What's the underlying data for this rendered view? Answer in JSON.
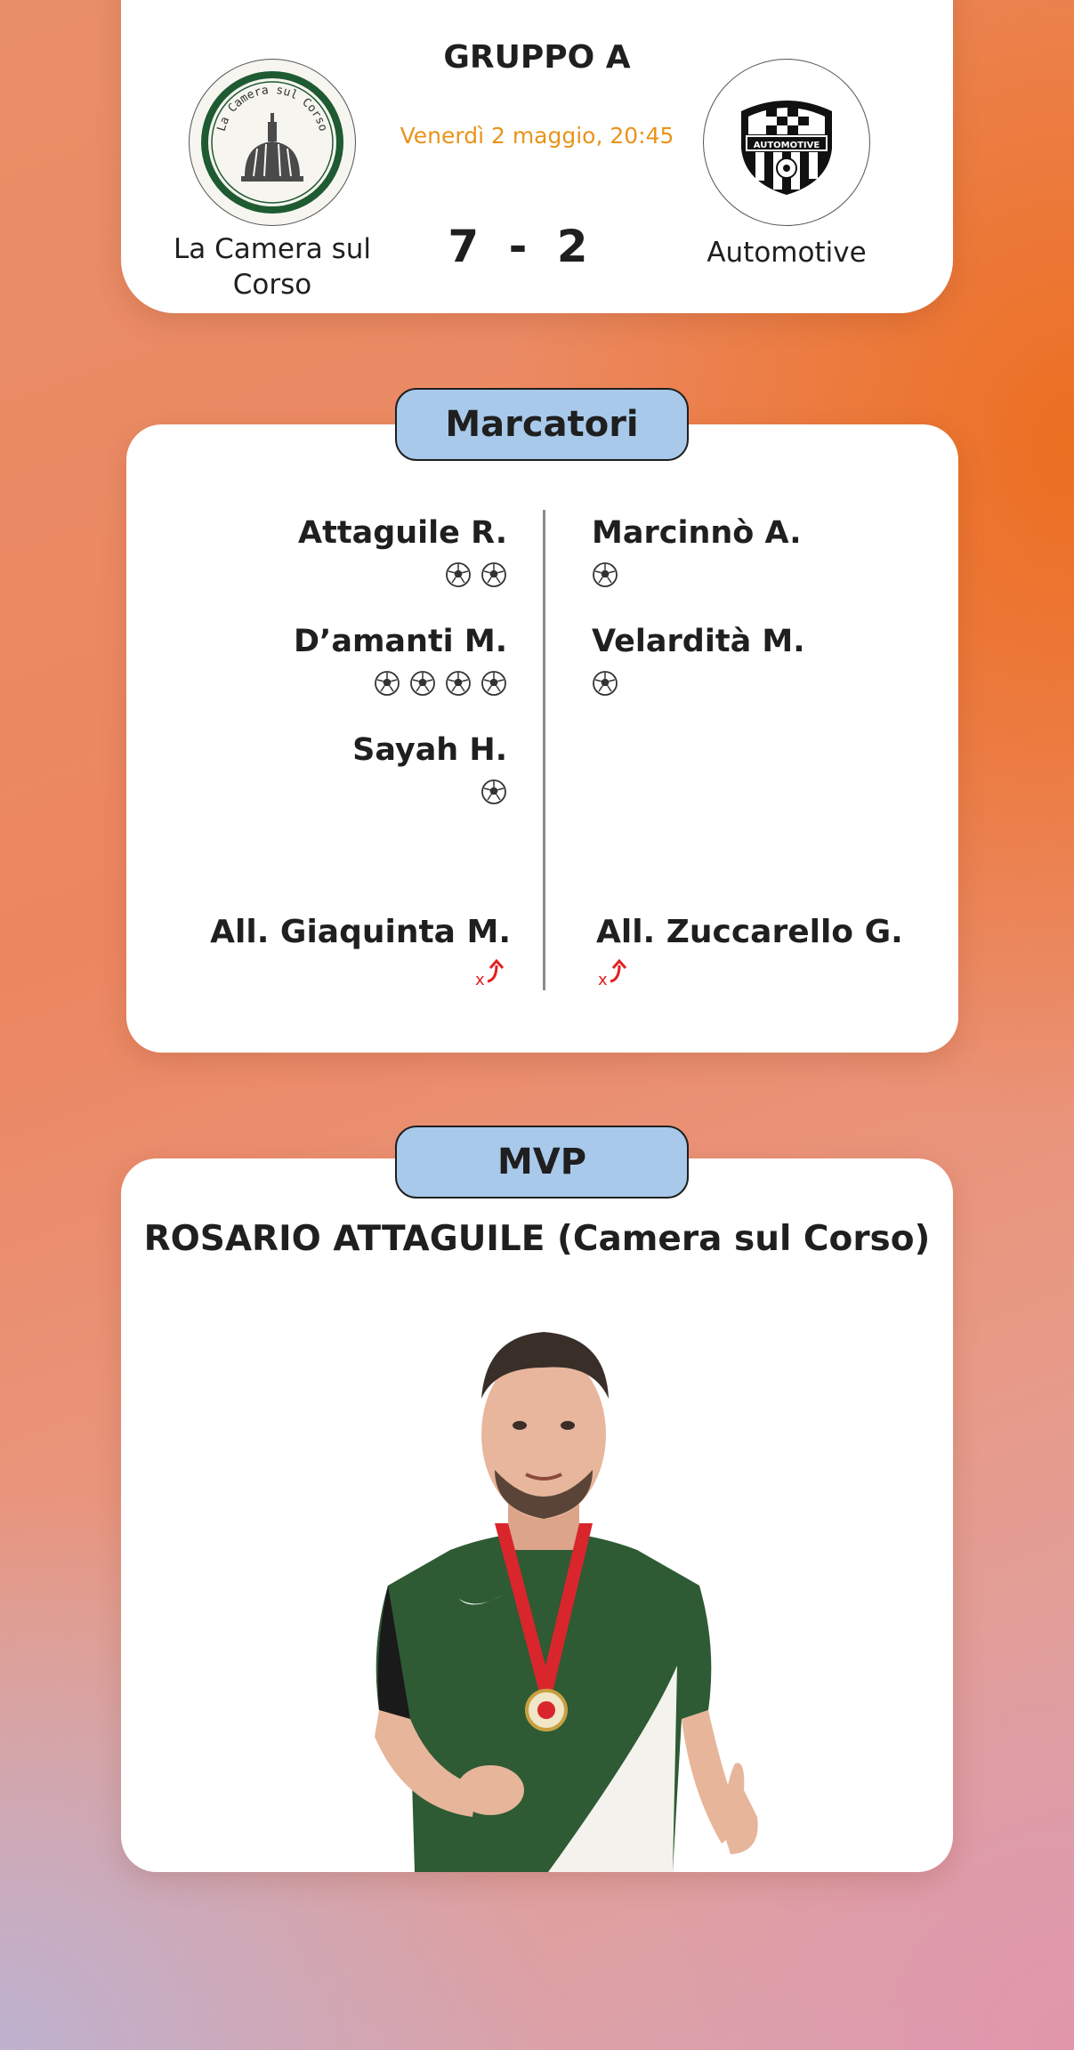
{
  "match": {
    "group": "GRUPPO A",
    "date": "Venerdì 2 maggio, 20:45",
    "home_team": {
      "name": "La Camera sul Corso",
      "logo_text": "La Camera sul Corso",
      "logo_icon": "dome-icon"
    },
    "away_team": {
      "name": "Automotive",
      "logo_text": "AUTOMOTIVE",
      "logo_icon": "shield-crest-icon"
    },
    "home_score": "7",
    "away_score": "2",
    "score_separator": "-"
  },
  "scorers": {
    "label": "Marcatori",
    "home": [
      {
        "name": "Attaguile R.",
        "goals": 2
      },
      {
        "name": "D’amanti M.",
        "goals": 4
      },
      {
        "name": "Sayah H.",
        "goals": 1
      }
    ],
    "away": [
      {
        "name": "Marcinnò A.",
        "goals": 1
      },
      {
        "name": "Velardità M.",
        "goals": 1
      }
    ],
    "home_coach": "All. Giaquinta M.",
    "away_coach": "All. Zuccarello G.",
    "goal_icon": "soccer-ball-icon",
    "coach_icon": "substitution-arrow-icon"
  },
  "mvp": {
    "label": "MVP",
    "player": "ROSARIO ATTAGUILE (Camera sul Corso)",
    "photo_icon": "player-photo"
  },
  "colors": {
    "accent_date": "#e8941a",
    "pill_bg": "#a8c9ea",
    "home_green": "#1e5a32",
    "coach_icon_red": "#e02020"
  }
}
